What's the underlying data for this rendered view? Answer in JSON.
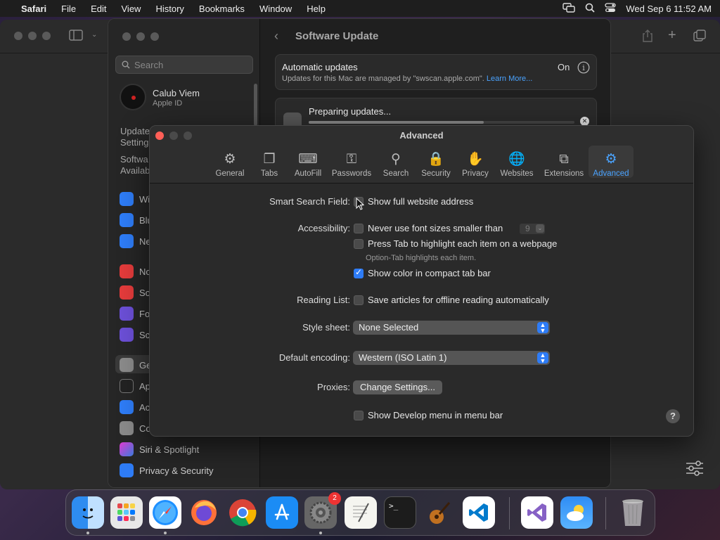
{
  "menubar": {
    "app": "Safari",
    "items": [
      "File",
      "Edit",
      "View",
      "History",
      "Bookmarks",
      "Window",
      "Help"
    ],
    "clock": "Wed Sep 6  11:52 AM"
  },
  "settings": {
    "search_placeholder": "Search",
    "account_name": "Calub Viem",
    "account_sub": "Apple ID",
    "update_notice_1": "Update",
    "update_notice_2": "Settings",
    "software_1": "Softwa",
    "software_2": "Availab",
    "sidebar_items": [
      {
        "label": "Wi",
        "color": "#2e7cf6"
      },
      {
        "label": "Blu",
        "color": "#2e7cf6"
      },
      {
        "label": "Ne",
        "color": "#2e7cf6"
      },
      {
        "label": "No",
        "color": "#e33b3b"
      },
      {
        "label": "So",
        "color": "#e33b3b"
      },
      {
        "label": "Fo",
        "color": "#6b4fd6"
      },
      {
        "label": "Sc",
        "color": "#6b4fd6"
      },
      {
        "label": "Ge",
        "color": "#8a8a8a"
      },
      {
        "label": "Ap",
        "color": "#222"
      },
      {
        "label": "Ac",
        "color": "#2e7cf6"
      },
      {
        "label": "Co",
        "color": "#8a8a8a"
      },
      {
        "label": "Siri & Spotlight",
        "color": "#b04ad0"
      },
      {
        "label": "Privacy & Security",
        "color": "#2e7cf6"
      }
    ],
    "main_title": "Software Update",
    "auto_updates_title": "Automatic updates",
    "auto_updates_sub": "Updates for this Mac are managed by \"swscan.apple.com\".",
    "learn_more": "Learn More...",
    "auto_updates_state": "On",
    "preparing": "Preparing updates..."
  },
  "advanced": {
    "title": "Advanced",
    "tabs": [
      {
        "label": "General",
        "icon": "⚙"
      },
      {
        "label": "Tabs",
        "icon": "❐"
      },
      {
        "label": "AutoFill",
        "icon": "⌨"
      },
      {
        "label": "Passwords",
        "icon": "⚿"
      },
      {
        "label": "Search",
        "icon": "⚲"
      },
      {
        "label": "Security",
        "icon": "🔒"
      },
      {
        "label": "Privacy",
        "icon": "✋"
      },
      {
        "label": "Websites",
        "icon": "🌐"
      },
      {
        "label": "Extensions",
        "icon": "⧉"
      },
      {
        "label": "Advanced",
        "icon": "⚙"
      }
    ],
    "smart_search_label": "Smart Search Field:",
    "show_full_address": "Show full website address",
    "accessibility_label": "Accessibility:",
    "never_font_sizes": "Never use font sizes smaller than",
    "font_size_value": "9",
    "press_tab": "Press Tab to highlight each item on a webpage",
    "option_tab_note": "Option-Tab highlights each item.",
    "show_color_compact": "Show color in compact tab bar",
    "reading_list_label": "Reading List:",
    "save_articles": "Save articles for offline reading automatically",
    "style_sheet_label": "Style sheet:",
    "style_sheet_value": "None Selected",
    "encoding_label": "Default encoding:",
    "encoding_value": "Western (ISO Latin 1)",
    "proxies_label": "Proxies:",
    "change_settings": "Change Settings...",
    "show_develop": "Show Develop menu in menu bar",
    "help": "?",
    "checked": {
      "show_full_address": false,
      "never_font_sizes": false,
      "press_tab": false,
      "show_color_compact": true,
      "save_articles": false,
      "show_develop": false
    }
  },
  "dock": {
    "settings_badge": "2"
  }
}
